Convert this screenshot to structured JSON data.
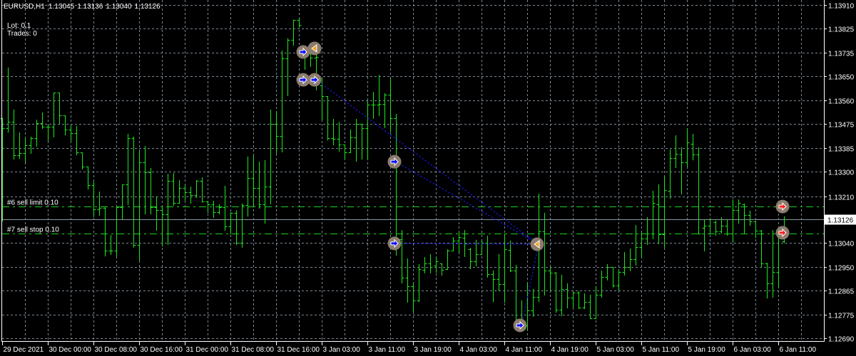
{
  "header": {
    "symbol": "EURUSD,H1",
    "open": "1.13045",
    "high": "1.13136",
    "low": "1.13040",
    "close": "1.13126"
  },
  "info": {
    "lot": "Lot: 0,1",
    "trades": "Trades: 0"
  },
  "orders": [
    {
      "label": "#6 sell limit 0.10",
      "price": 1.13172
    },
    {
      "label": "#7 sell stop 0.10",
      "price": 1.13073
    }
  ],
  "bid": {
    "label": "1.13126",
    "price": 1.13126
  },
  "colors": {
    "background": "#000000",
    "grid": "#7b8796",
    "bar": "#1ee61e",
    "order_line": "#1ed21e",
    "bid_line": "#8a96a4",
    "buy_arrow": "#1010ff",
    "close_arrow": "#f0a020",
    "pending_arrow": "#ff2020",
    "marker_bg": "#8b7c6e",
    "trade_line": "#1a1aff",
    "axis_text": "#ffffff"
  },
  "chart_data": {
    "type": "ohlc",
    "title": "EURUSD,H1",
    "ylim": [
      1.1269,
      1.1391
    ],
    "grid": true,
    "y_ticks": [
      "1.13910",
      "1.13825",
      "1.13735",
      "1.13650",
      "1.13560",
      "1.13475",
      "1.13385",
      "1.13300",
      "1.13210",
      "1.13040",
      "1.12950",
      "1.12865",
      "1.12775",
      "1.12690"
    ],
    "x_ticks": [
      "29 Dec 2021",
      "30 Dec 00:00",
      "30 Dec 08:00",
      "30 Dec 16:00",
      "31 Dec 00:00",
      "31 Dec 08:00",
      "31 Dec 16:00",
      "3 Jan 03:00",
      "3 Jan 11:00",
      "3 Jan 19:00",
      "4 Jan 03:00",
      "4 Jan 11:00",
      "4 Jan 19:00",
      "5 Jan 03:00",
      "5 Jan 11:00",
      "5 Jan 19:00",
      "6 Jan 03:00",
      "6 Jan 11:00"
    ],
    "x_tick_bars": [
      1,
      9,
      17,
      25,
      33,
      41,
      49,
      57,
      65,
      73,
      81,
      89,
      97,
      105,
      113,
      121,
      129,
      137
    ],
    "ohlc": [
      [
        1.13496,
        1.13496,
        1.1312,
        1.13459
      ],
      [
        1.13459,
        1.13681,
        1.13446,
        1.13482
      ],
      [
        1.13482,
        1.13527,
        1.13347,
        1.1336
      ],
      [
        1.1336,
        1.13443,
        1.13349,
        1.13368
      ],
      [
        1.13368,
        1.13422,
        1.13336,
        1.13396
      ],
      [
        1.13396,
        1.13428,
        1.13368,
        1.13422
      ],
      [
        1.13422,
        1.1349,
        1.13394,
        1.13477
      ],
      [
        1.13477,
        1.13516,
        1.13459,
        1.13464
      ],
      [
        1.13464,
        1.13472,
        1.13415,
        1.13464
      ],
      [
        1.13464,
        1.13589,
        1.13428,
        1.13589
      ],
      [
        1.13589,
        1.13589,
        1.13477,
        1.13506
      ],
      [
        1.13506,
        1.13506,
        1.13435,
        1.13454
      ],
      [
        1.13454,
        1.13467,
        1.13415,
        1.13441
      ],
      [
        1.13441,
        1.13467,
        1.13362,
        1.1337
      ],
      [
        1.1337,
        1.1337,
        1.1331,
        1.13318
      ],
      [
        1.13318,
        1.13318,
        1.13237,
        1.1325
      ],
      [
        1.1325,
        1.13263,
        1.13136,
        1.13162
      ],
      [
        1.13162,
        1.13227,
        1.13141,
        1.13167
      ],
      [
        1.13167,
        1.1317,
        1.12992,
        1.13011
      ],
      [
        1.13011,
        1.13068,
        1.12998,
        1.13011
      ],
      [
        1.13011,
        1.1317,
        1.12992,
        1.1317
      ],
      [
        1.1317,
        1.13253,
        1.13128,
        1.13253
      ],
      [
        1.13253,
        1.13438,
        1.1318,
        1.13422
      ],
      [
        1.13422,
        1.13428,
        1.13024,
        1.13032
      ],
      [
        1.13032,
        1.13376,
        1.12977,
        1.13334
      ],
      [
        1.13334,
        1.13394,
        1.13146,
        1.13297
      ],
      [
        1.13297,
        1.13313,
        1.13146,
        1.1317
      ],
      [
        1.1317,
        1.13209,
        1.13086,
        1.13159
      ],
      [
        1.13159,
        1.1317,
        1.13029,
        1.13143
      ],
      [
        1.13143,
        1.13292,
        1.13034,
        1.13266
      ],
      [
        1.13266,
        1.13295,
        1.13177,
        1.13185
      ],
      [
        1.13185,
        1.13269,
        1.13185,
        1.1324
      ],
      [
        1.1324,
        1.1325,
        1.13196,
        1.13224
      ],
      [
        1.13224,
        1.13245,
        1.13185,
        1.13214
      ],
      [
        1.13214,
        1.13269,
        1.13206,
        1.13266
      ],
      [
        1.13266,
        1.13279,
        1.1319,
        1.1319
      ],
      [
        1.1319,
        1.13193,
        1.13151,
        1.1318
      ],
      [
        1.1318,
        1.13193,
        1.13133,
        1.13151
      ],
      [
        1.13151,
        1.1318,
        1.13146,
        1.1317
      ],
      [
        1.1317,
        1.13248,
        1.13086,
        1.13099
      ],
      [
        1.13099,
        1.13151,
        1.13073,
        1.13149
      ],
      [
        1.13149,
        1.13159,
        1.13034,
        1.13039
      ],
      [
        1.13039,
        1.13183,
        1.13024,
        1.13177
      ],
      [
        1.13177,
        1.13355,
        1.13138,
        1.13277
      ],
      [
        1.13277,
        1.1336,
        1.13172,
        1.1324
      ],
      [
        1.1324,
        1.13336,
        1.13167,
        1.1318
      ],
      [
        1.1318,
        1.13342,
        1.13112,
        1.13245
      ],
      [
        1.13245,
        1.13527,
        1.13183,
        1.13475
      ],
      [
        1.13475,
        1.13522,
        1.13368,
        1.1343
      ],
      [
        1.1343,
        1.13743,
        1.13373,
        1.13715
      ],
      [
        1.13715,
        1.13788,
        1.13579,
        1.13782
      ],
      [
        1.13782,
        1.13855,
        1.13764,
        1.13855
      ],
      [
        1.13855,
        1.1386,
        1.13829,
        1.13837
      ],
      [
        1.13746,
        1.1375,
        1.13675,
        1.13733
      ],
      [
        1.13733,
        1.13764,
        1.13686,
        1.13717
      ],
      [
        1.13717,
        1.13751,
        1.136,
        1.1372
      ],
      [
        1.13615,
        1.13644,
        1.1349,
        1.13576
      ],
      [
        1.13576,
        1.13576,
        1.13417,
        1.13422
      ],
      [
        1.13422,
        1.13493,
        1.13399,
        1.1342
      ],
      [
        1.1342,
        1.13482,
        1.13376,
        1.13399
      ],
      [
        1.13399,
        1.13399,
        1.13349,
        1.1337
      ],
      [
        1.1337,
        1.13454,
        1.1337,
        1.13425
      ],
      [
        1.13425,
        1.13493,
        1.13339,
        1.13475
      ],
      [
        1.13475,
        1.13475,
        1.13347,
        1.13459
      ],
      [
        1.13459,
        1.13558,
        1.13347,
        1.13545
      ],
      [
        1.13545,
        1.13592,
        1.13496,
        1.13545
      ],
      [
        1.13545,
        1.13654,
        1.13506,
        1.13548
      ],
      [
        1.13548,
        1.13587,
        1.13462,
        1.13581
      ],
      [
        1.13581,
        1.13641,
        1.13448,
        1.13496
      ],
      [
        1.13496,
        1.13511,
        1.12995,
        1.13052
      ],
      [
        1.13052,
        1.13086,
        1.12893,
        1.12911
      ],
      [
        1.12911,
        1.12982,
        1.12823,
        1.1288
      ],
      [
        1.1288,
        1.12891,
        1.12789,
        1.12828
      ],
      [
        1.12828,
        1.12961,
        1.12825,
        1.12943
      ],
      [
        1.1294,
        1.12987,
        1.1293,
        1.12964
      ],
      [
        1.12964,
        1.12998,
        1.1293,
        1.12951
      ],
      [
        1.12956,
        1.12987,
        1.12932,
        1.12971
      ],
      [
        1.12964,
        1.12964,
        1.12922,
        1.1294
      ],
      [
        1.12943,
        1.13016,
        1.12943,
        1.13011
      ],
      [
        1.13011,
        1.1306,
        1.13011,
        1.13047
      ],
      [
        1.13047,
        1.13078,
        1.13005,
        1.1306
      ],
      [
        1.13057,
        1.13086,
        1.1299,
        1.13037
      ],
      [
        1.13016,
        1.13021,
        1.12945,
        1.12971
      ],
      [
        1.12971,
        1.1305,
        1.12956,
        1.12998
      ],
      [
        1.12998,
        1.1305,
        1.12998,
        1.13039
      ],
      [
        1.13039,
        1.13065,
        1.12914,
        1.12925
      ],
      [
        1.12925,
        1.12938,
        1.12825,
        1.12906
      ],
      [
        1.12906,
        1.12998,
        1.12865,
        1.12888
      ],
      [
        1.12888,
        1.13073,
        1.12823,
        1.13016
      ],
      [
        1.13013,
        1.13047,
        1.12935,
        1.12938
      ],
      [
        1.12938,
        1.12958,
        1.1275,
        1.12755
      ],
      [
        1.12755,
        1.12828,
        1.12721,
        1.12737
      ],
      [
        1.12737,
        1.12893,
        1.12721,
        1.12792
      ],
      [
        1.12792,
        1.1287,
        1.12771,
        1.12841
      ],
      [
        1.12841,
        1.13219,
        1.12825,
        1.13081
      ],
      [
        1.13081,
        1.13149,
        1.12849,
        1.12938
      ],
      [
        1.12938,
        1.12951,
        1.12867,
        1.1293
      ],
      [
        1.1293,
        1.12932,
        1.12786,
        1.12794
      ],
      [
        1.12794,
        1.12922,
        1.12773,
        1.1287
      ],
      [
        1.1287,
        1.12891,
        1.12802,
        1.12838
      ],
      [
        1.12838,
        1.12859,
        1.12805,
        1.12857
      ],
      [
        1.12857,
        1.12862,
        1.12799,
        1.12802
      ],
      [
        1.12802,
        1.12854,
        1.12799,
        1.12823
      ],
      [
        1.12823,
        1.12849,
        1.12763,
        1.12763
      ],
      [
        1.12763,
        1.1288,
        1.12763,
        1.12849
      ],
      [
        1.12849,
        1.12938,
        1.12841,
        1.12914
      ],
      [
        1.12914,
        1.12961,
        1.12904,
        1.12951
      ],
      [
        1.12951,
        1.12951,
        1.12878,
        1.12883
      ],
      [
        1.12883,
        1.1294,
        1.12867,
        1.12932
      ],
      [
        1.12932,
        1.13005,
        1.12922,
        1.12951
      ],
      [
        1.12951,
        1.13018,
        1.12938,
        1.12979
      ],
      [
        1.12979,
        1.13104,
        1.12958,
        1.13024
      ],
      [
        1.13024,
        1.13078,
        1.1299,
        1.13055
      ],
      [
        1.13055,
        1.13133,
        1.13034,
        1.13073
      ],
      [
        1.13073,
        1.1323,
        1.13055,
        1.13185
      ],
      [
        1.1318,
        1.13253,
        1.13037,
        1.1307
      ],
      [
        1.1307,
        1.13282,
        1.13024,
        1.13232
      ],
      [
        1.1323,
        1.13381,
        1.13203,
        1.13349
      ],
      [
        1.13349,
        1.13433,
        1.13316,
        1.13365
      ],
      [
        1.13362,
        1.13389,
        1.13219,
        1.13334
      ],
      [
        1.13334,
        1.13459,
        1.13321,
        1.13407
      ],
      [
        1.13402,
        1.13438,
        1.13344,
        1.13362
      ],
      [
        1.13362,
        1.13389,
        1.13073,
        1.13073
      ],
      [
        1.13094,
        1.13125,
        1.13011,
        1.13102
      ],
      [
        1.13102,
        1.13125,
        1.13073,
        1.13125
      ],
      [
        1.13115,
        1.1312,
        1.13068,
        1.13081
      ],
      [
        1.13081,
        1.13133,
        1.13076,
        1.13102
      ],
      [
        1.13102,
        1.13125,
        1.13068,
        1.13073
      ],
      [
        1.13073,
        1.13198,
        1.13042,
        1.13159
      ],
      [
        1.13159,
        1.13198,
        1.13112,
        1.13185
      ],
      [
        1.1318,
        1.13183,
        1.13076,
        1.13141
      ],
      [
        1.13141,
        1.13157,
        1.13104,
        1.13117
      ],
      [
        1.13117,
        1.1312,
        1.1306,
        1.13084
      ],
      [
        1.13084,
        1.13086,
        1.12951,
        1.12964
      ],
      [
        1.12964,
        1.12966,
        1.12838,
        1.12891
      ],
      [
        1.12891,
        1.13086,
        1.12841,
        1.12932
      ],
      [
        1.12932,
        1.13078,
        1.1288,
        1.13068
      ],
      [
        1.13045,
        1.13136,
        1.1304,
        1.13126
      ]
    ],
    "trade_markers": [
      {
        "type": "buy",
        "bar": 54,
        "price": 1.13738
      },
      {
        "type": "close",
        "bar": 56,
        "price": 1.13751
      },
      {
        "type": "buy",
        "bar": 54,
        "price": 1.13636
      },
      {
        "type": "buy",
        "bar": 56,
        "price": 1.13636
      },
      {
        "type": "buy",
        "bar": 70,
        "price": 1.13336
      },
      {
        "type": "buy",
        "bar": 70,
        "price": 1.13037
      },
      {
        "type": "buy",
        "bar": 92,
        "price": 1.12737
      },
      {
        "type": "close",
        "bar": 95,
        "price": 1.13034
      },
      {
        "type": "pending",
        "bar": 138,
        "price": 1.13172
      },
      {
        "type": "pending",
        "bar": 138,
        "price": 1.13076
      }
    ],
    "trade_lines": [
      {
        "style": "solid",
        "from_bar": 54,
        "from_price": 1.13738,
        "to_bar": 56,
        "to_price": 1.13751
      },
      {
        "style": "solid",
        "from_bar": 54,
        "from_price": 1.13636,
        "to_bar": 56,
        "to_price": 1.13636
      },
      {
        "style": "dotted",
        "from_bar": 56,
        "from_price": 1.13636,
        "to_bar": 95,
        "to_price": 1.13034
      },
      {
        "style": "dotted",
        "from_bar": 70,
        "from_price": 1.13336,
        "to_bar": 95,
        "to_price": 1.13034
      },
      {
        "style": "dotted",
        "from_bar": 70,
        "from_price": 1.13037,
        "to_bar": 95,
        "to_price": 1.13034
      },
      {
        "style": "dotted",
        "from_bar": 92,
        "from_price": 1.12737,
        "to_bar": 95,
        "to_price": 1.13034
      }
    ]
  }
}
